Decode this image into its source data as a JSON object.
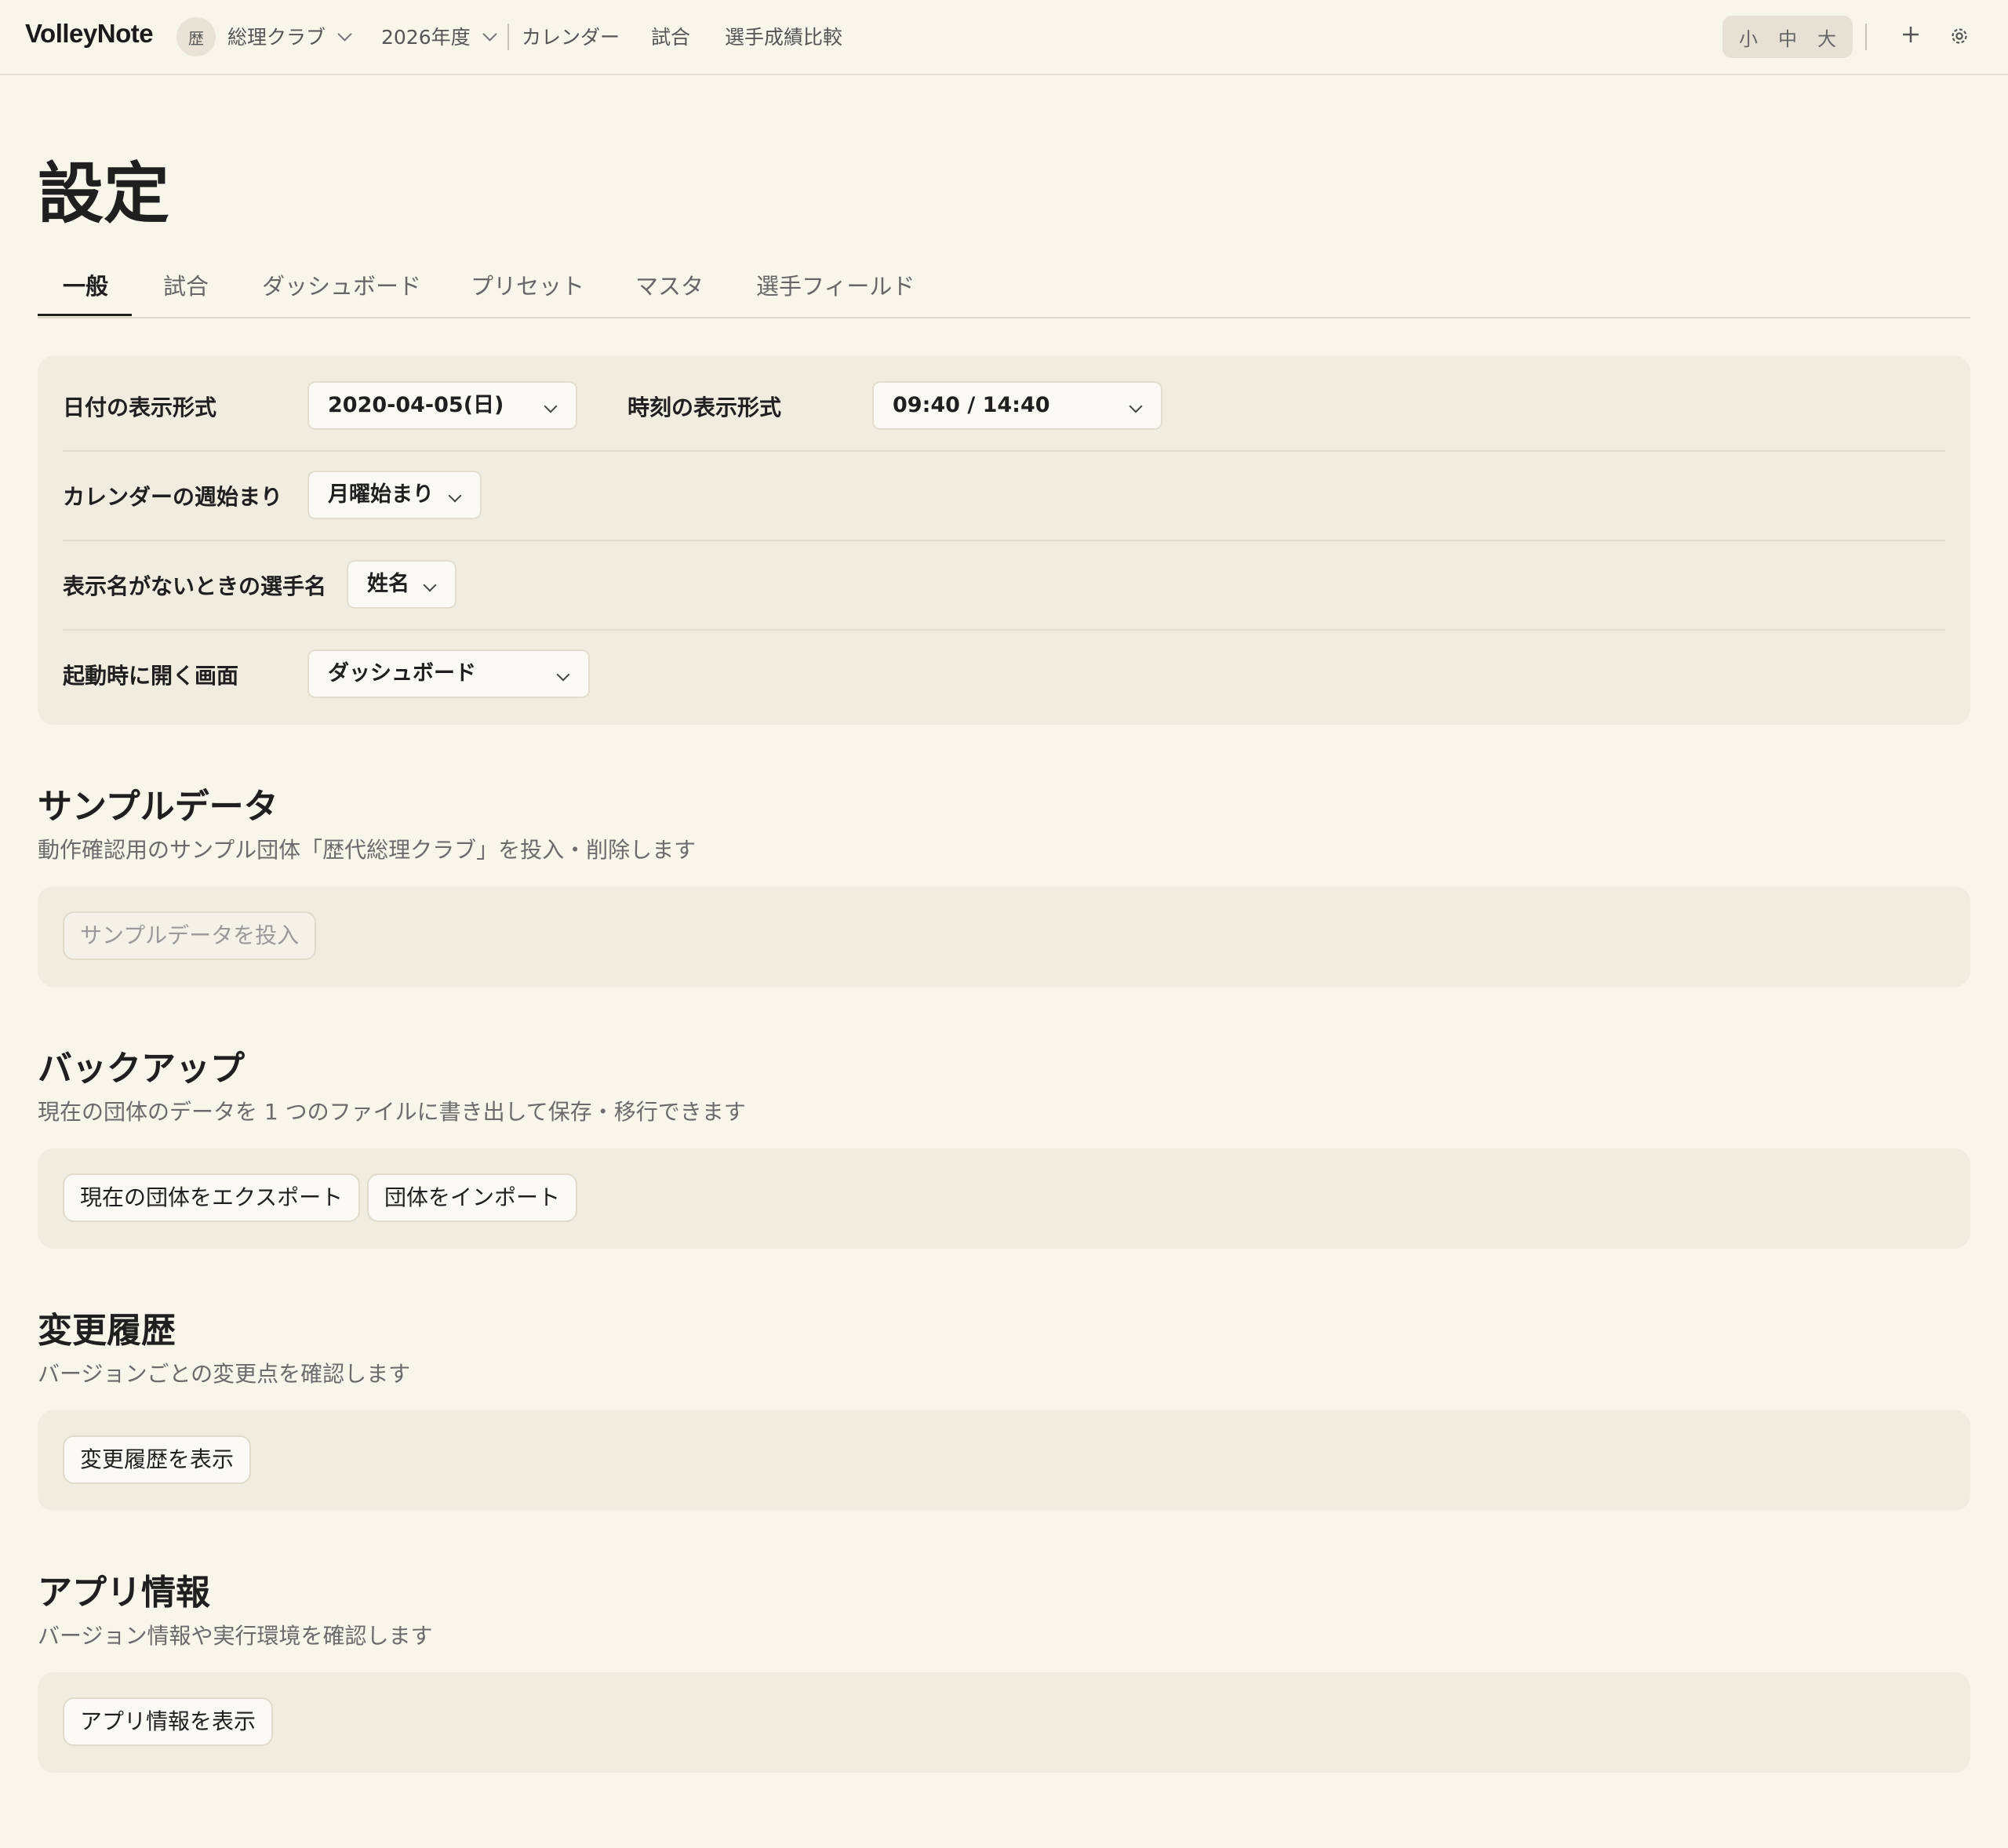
{
  "header": {
    "brand": "VolleyNote",
    "club_avatar": "歴",
    "club_name": "総理クラブ",
    "season": "2026年度",
    "nav": [
      "カレンダー",
      "試合",
      "選手成績比較"
    ],
    "size_options": [
      "小",
      "中",
      "大"
    ],
    "icons": [
      "plus-icon",
      "gear-icon"
    ]
  },
  "page": {
    "title": "設定",
    "tabs": [
      "一般",
      "試合",
      "ダッシュボード",
      "プリセット",
      "マスタ",
      "選手フィールド"
    ],
    "active_tab": "一般"
  },
  "general": {
    "date_format_label": "日付の表示形式",
    "date_format_value": "2020-04-05(日)",
    "time_format_label": "時刻の表示形式",
    "time_format_value": "09:40 / 14:40",
    "week_start_label": "カレンダーの週始まり",
    "week_start_value": "月曜始まり",
    "player_name_label": "表示名がないときの選手名",
    "player_name_value": "姓名",
    "startup_label": "起動時に開く画面",
    "startup_value": "ダッシュボード"
  },
  "sections": {
    "sample": {
      "title": "サンプルデータ",
      "desc": "動作確認用のサンプル団体「歴代総理クラブ」を投入・削除します",
      "button": "サンプルデータを投入"
    },
    "backup": {
      "title": "バックアップ",
      "desc": "現在の団体のデータを 1 つのファイルに書き出して保存・移行できます",
      "export_button": "現在の団体をエクスポート",
      "import_button": "団体をインポート"
    },
    "changelog": {
      "title": "変更履歴",
      "desc": "バージョンごとの変更点を確認します",
      "button": "変更履歴を表示"
    },
    "appinfo": {
      "title": "アプリ情報",
      "desc": "バージョン情報や実行環境を確認します",
      "button": "アプリ情報を表示"
    }
  }
}
